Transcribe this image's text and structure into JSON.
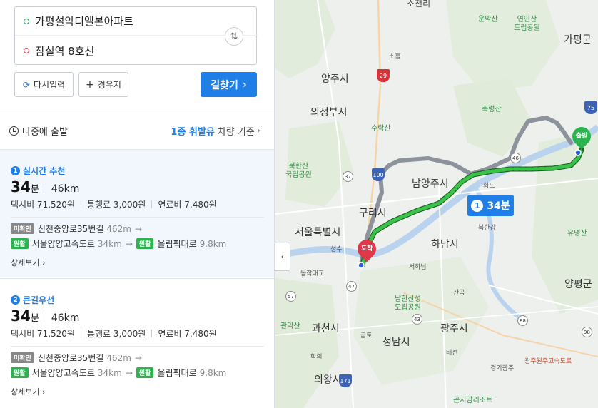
{
  "search": {
    "origin": "가평설악디엘본아파트",
    "destination": "잠실역 8호선"
  },
  "buttons": {
    "reset_label": "다시입력",
    "via_label": "경유지",
    "go_label": "길찾기"
  },
  "depart": {
    "label": "나중에 출발",
    "fuel": "1종 휘발유",
    "vehicle": "차량 기준"
  },
  "routes": [
    {
      "num": "1",
      "title": "실시간 추천",
      "time": "34",
      "time_unit": "분",
      "distance": "46km",
      "taxi": "택시비 71,520원",
      "toll": "통행료 3,000원",
      "fuel_cost": "연료비 7,480원",
      "unverified_tag": "미확인",
      "road1": "신천중앙로35번길",
      "road1_dist": "462m",
      "smooth_tag": "원활",
      "road2": "서울양양고속도로",
      "road2_dist": "34km",
      "road3": "올림픽대로",
      "road3_dist": "9.8km",
      "detail": "상세보기"
    },
    {
      "num": "2",
      "title": "큰길우선",
      "time": "34",
      "time_unit": "분",
      "distance": "46km",
      "taxi": "택시비 71,520원",
      "toll": "통행료 3,000원",
      "fuel_cost": "연료비 7,480원",
      "unverified_tag": "미확인",
      "road1": "신천중앙로35번길",
      "road1_dist": "462m",
      "smooth_tag": "원활",
      "road2": "서울양양고속도로",
      "road2_dist": "34km",
      "road3": "올림픽대로",
      "road3_dist": "9.8km",
      "detail": "상세보기"
    }
  ],
  "map": {
    "bubble_num": "1",
    "bubble_time": "34분",
    "start_pin": "출발",
    "end_pin": "도착",
    "labels": {
      "sochon": "소천리",
      "gapyeong": "가평군",
      "yangju": "양주시",
      "uijeongbu": "의정부시",
      "namyangju": "남양주시",
      "guri": "구리시",
      "seoul": "서울특별시",
      "hanam": "하남시",
      "yangpyeong": "양평군",
      "gwacheon": "과천시",
      "gwangju": "광주시",
      "seongnam": "성남시",
      "uiwang": "의왕시",
      "bukhan": "북한강",
      "unak": "운악산",
      "yeonin": "연인산\n도립공원",
      "chukryeong": "축령산",
      "suraksan": "수락산",
      "bukhansan": "북한산\n국립공원",
      "yumyeong": "유명산",
      "namhansan": "남한산성\n도립공원",
      "gwanak": "관악산",
      "gonjiam": "곤지암리조트",
      "hwado": "화도",
      "soheul": "소흘",
      "seongsu": "성수",
      "dongjak": "동작대교",
      "seohasan": "서하남",
      "sangok": "산곡",
      "geumto": "금토",
      "hakui": "학의",
      "taejeon": "태전",
      "gyeonggi_gwangju": "경기광주",
      "gwangju_wonju": "광주원주고속도로"
    },
    "shields": {
      "s29": "29",
      "s46": "46",
      "s100": "100",
      "s75": "75",
      "s37": "37",
      "s47": "47",
      "s171": "171",
      "s57": "57",
      "s43": "43",
      "s98": "98",
      "s88": "88"
    }
  }
}
